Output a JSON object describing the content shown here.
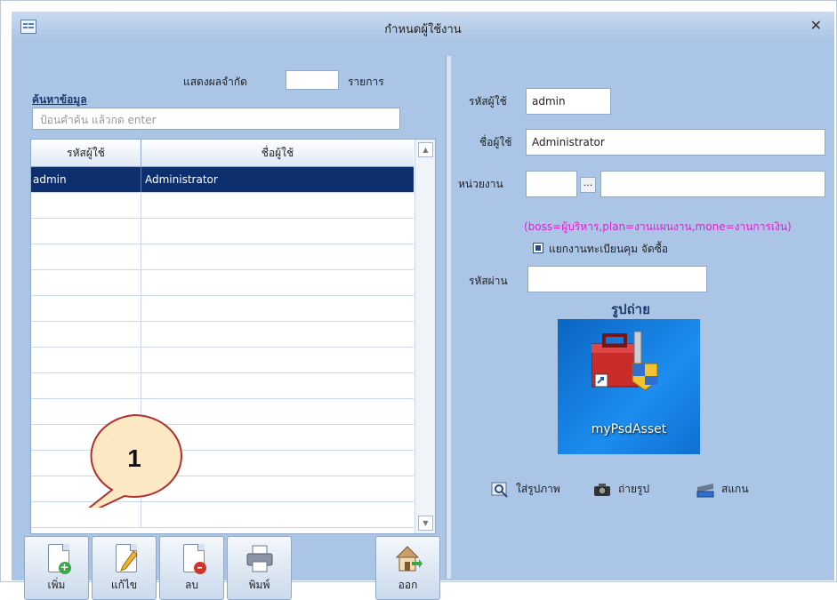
{
  "window": {
    "title": "กำหนดผู้ใช้งาน",
    "close_glyph": "✕"
  },
  "search": {
    "section_title": "ค้นหาข้อมูล",
    "placeholder": "ป้อนคำค้น แล้วกด enter",
    "limit_label": "แสดงผลจำกัด",
    "limit_value": "",
    "limit_unit": "รายการ"
  },
  "table": {
    "columns": [
      "รหัสผู้ใช้",
      "ชื่อผู้ใช้"
    ],
    "rows": [
      {
        "code": "admin",
        "name": "Administrator",
        "selected": true
      }
    ]
  },
  "toolbar": {
    "add_label": "เพิ่ม",
    "edit_label": "แก้ไข",
    "delete_label": "ลบ",
    "print_label": "พิมพ์",
    "exit_label": "ออก"
  },
  "callout": {
    "number": "1"
  },
  "form": {
    "user_code_label": "รหัสผู้ใช้",
    "user_code_value": "admin",
    "user_name_label": "ชื่อผู้ใช้",
    "user_name_value": "Administrator",
    "department_label": "หน่วยงาน",
    "department_code_value": "",
    "department_browse": "...",
    "department_name_value": "",
    "role_hint": "(boss=ผู้บริหาร,plan=งานแผนงาน,mone=งานการเงิน)",
    "separate_registry_label": "แยกงานทะเบียนคุม จัดซื้อ",
    "separate_registry_checked": true,
    "password_label": "รหัสผ่าน",
    "password_value": "",
    "photo_title": "รูปถ่าย",
    "photo_caption": "myPsdAsset"
  },
  "photo_actions": {
    "insert_label": "ใส่รูปภาพ",
    "capture_label": "ถ่ายรูป",
    "scan_label": "สแกน"
  },
  "colors": {
    "frame": "#aac5e6",
    "selected_row": "#0d2f6e",
    "hint": "#e020c8",
    "callout_fill": "#fde8c4",
    "callout_border": "#b03030"
  }
}
